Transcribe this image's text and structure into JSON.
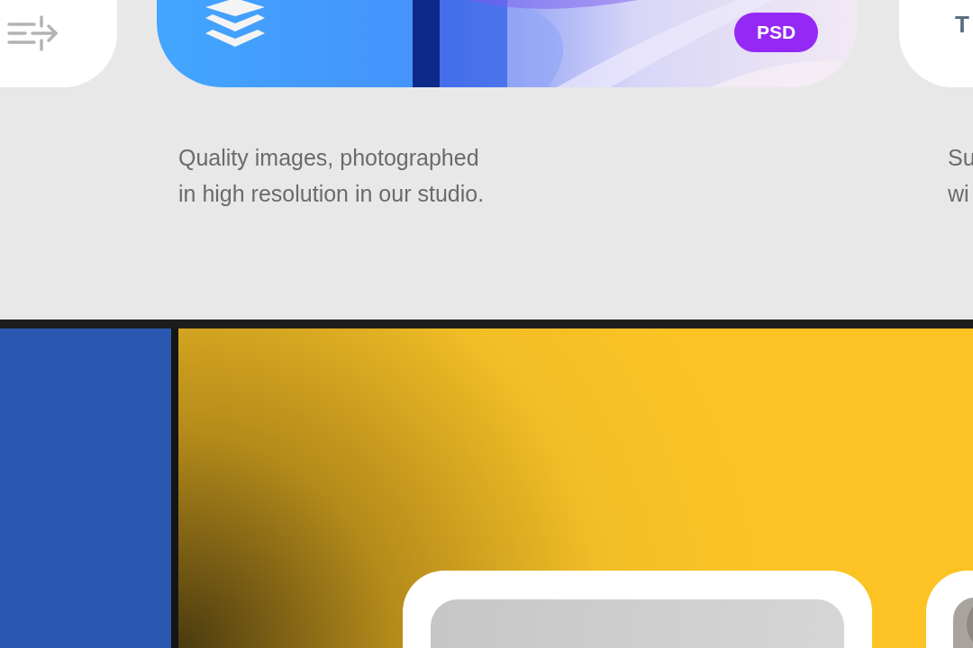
{
  "feature_card": {
    "badge": "PSD",
    "description": [
      "Quality images, photographed",
      "in high resolution in our studio."
    ]
  },
  "next_card": {
    "title": "T",
    "description": [
      "Su",
      "wi"
    ]
  }
}
